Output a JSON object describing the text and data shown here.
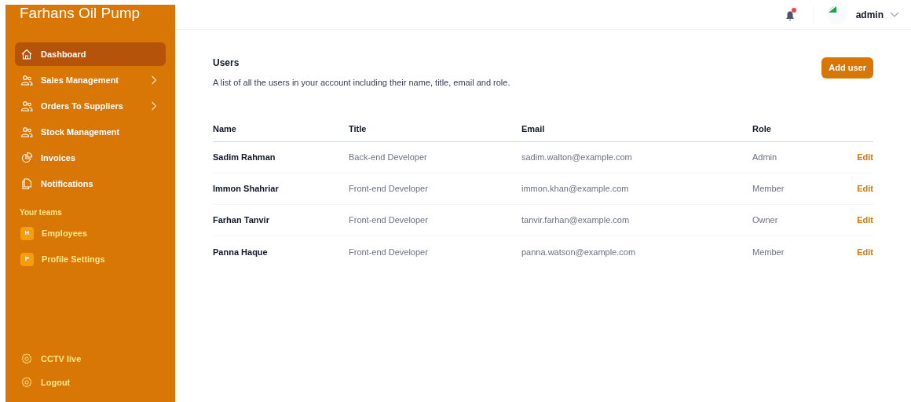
{
  "app_title": "Farhans Oil Pump",
  "nav": [
    {
      "label": "Dashboard",
      "kind": "home",
      "selected": true,
      "expandable": false
    },
    {
      "label": "Sales Management",
      "kind": "users",
      "selected": false,
      "expandable": true
    },
    {
      "label": "Orders To Suppliers",
      "kind": "users",
      "selected": false,
      "expandable": true
    },
    {
      "label": "Stock Management",
      "kind": "users",
      "selected": false,
      "expandable": false
    },
    {
      "label": "Invoices",
      "kind": "pie",
      "selected": false,
      "expandable": false
    },
    {
      "label": "Notifications",
      "kind": "docs",
      "selected": false,
      "expandable": false
    }
  ],
  "teams_heading": "Your teams",
  "teams": [
    {
      "initial": "H",
      "label": "Employees"
    },
    {
      "initial": "P",
      "label": "Profile Settings"
    }
  ],
  "bottom_nav": [
    {
      "label": "CCTV live"
    },
    {
      "label": "Logout"
    }
  ],
  "header": {
    "notification_dot": true,
    "user": "admin"
  },
  "users": {
    "title": "Users",
    "description": "A list of all the users in your account including their name, title, email and role.",
    "add_button": "Add user",
    "columns": [
      "Name",
      "Title",
      "Email",
      "Role"
    ],
    "rows": [
      {
        "name": "Sadim Rahman",
        "title": "Back-end Developer",
        "email": "sadim.walton@example.com",
        "role": "Admin",
        "action": "Edit"
      },
      {
        "name": "Immon Shahriar",
        "title": "Front-end Developer",
        "email": "immon.khan@example.com",
        "role": "Member",
        "action": "Edit"
      },
      {
        "name": "Farhan Tanvir",
        "title": "Front-end Developer",
        "email": "tanvir.farhan@example.com",
        "role": "Owner",
        "action": "Edit"
      },
      {
        "name": "Panna Haque",
        "title": "Front-end Developer",
        "email": "panna.watson@example.com",
        "role": "Member",
        "action": "Edit"
      }
    ]
  }
}
